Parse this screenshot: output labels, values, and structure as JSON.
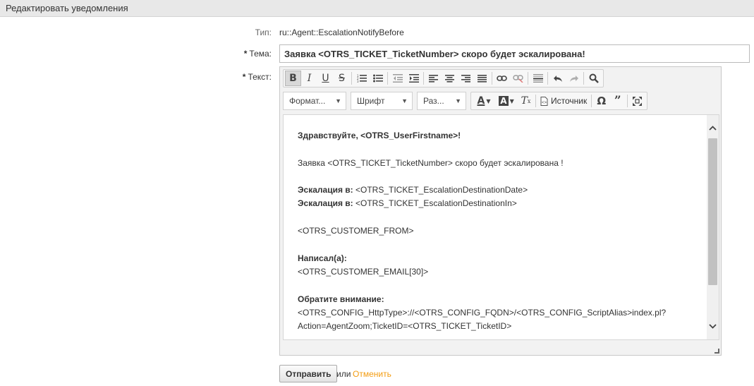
{
  "header": {
    "title": "Редактировать уведомления"
  },
  "form": {
    "type_label": "Тип:",
    "type_value": "ru::Agent::EscalationNotifyBefore",
    "subject_label": "Тема:",
    "subject_required_mark": "*",
    "subject_value": "Заявка <OTRS_TICKET_TicketNumber> скоро будет эскалирована!",
    "text_label": "Текст:",
    "text_required_mark": "*"
  },
  "toolbar": {
    "row1": [
      "bold-icon",
      "italic-icon",
      "underline-icon",
      "strikethrough-icon",
      "numbered-list-icon",
      "bulleted-list-icon",
      "outdent-icon",
      "indent-icon",
      "align-left-icon",
      "align-center-icon",
      "align-right-icon",
      "justify-icon",
      "link-icon",
      "unlink-icon",
      "horizontal-rule-icon",
      "undo-icon",
      "redo-icon",
      "find-icon"
    ],
    "format_label": "Формат...",
    "font_label": "Шрифт",
    "size_label": "Раз...",
    "source_label": "Источник"
  },
  "editor_content": {
    "greeting_bold": "Здравствуйте, <OTRS_UserFirstname>!",
    "line_ticket": "Заявка <OTRS_TICKET_TicketNumber> скоро будет эскалирована !",
    "escalation_label_1": "Эскалация в:",
    "escalation_value_1": " <OTRS_TICKET_EscalationDestinationDate>",
    "escalation_label_2": "Эскалация в:",
    "escalation_value_2": " <OTRS_TICKET_EscalationDestinationIn>",
    "customer_from": "<OTRS_CUSTOMER_FROM>",
    "wrote_label": "Написал(а):",
    "customer_email": "<OTRS_CUSTOMER_EMAIL[30]>",
    "attention_label": "Обратите внимание:",
    "url_line": "<OTRS_CONFIG_HttpType>://<OTRS_CONFIG_FQDN>/<OTRS_CONFIG_ScriptAlias>index.pl?",
    "action_line": "Action=AgentZoom;TicketID=<OTRS_TICKET_TicketID>"
  },
  "actions": {
    "submit_label": "Отправить",
    "or_text": "или",
    "cancel_label": "Отменить"
  },
  "colors": {
    "cancel_link": "#f39c12",
    "header_bg": "#e8e8e8"
  }
}
